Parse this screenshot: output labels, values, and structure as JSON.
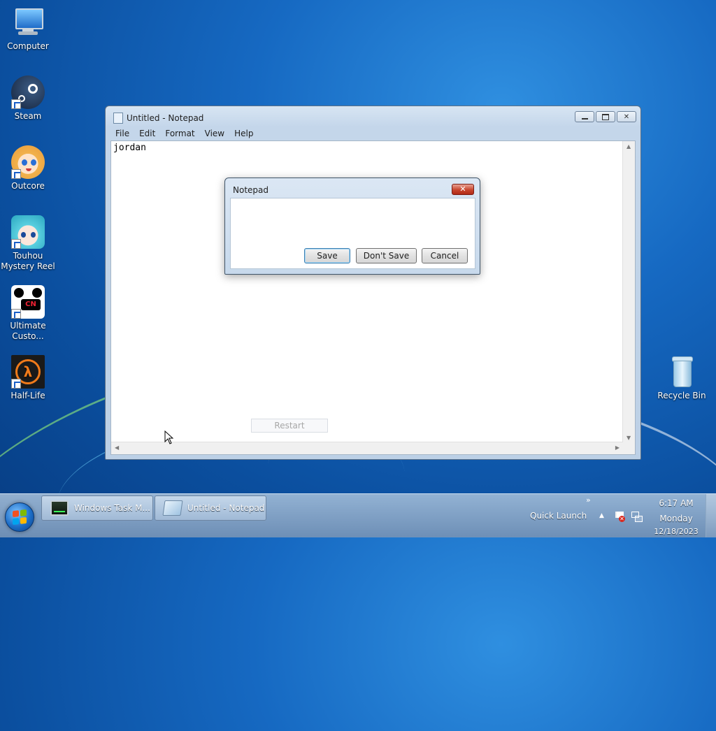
{
  "desktop": {
    "icons": [
      {
        "label": "Computer",
        "icon": "computer-icon"
      },
      {
        "label": "Steam",
        "icon": "steam-icon"
      },
      {
        "label": "Outcore",
        "icon": "outcore-icon"
      },
      {
        "label": "Touhou\nMystery Reel",
        "icon": "touhou-icon"
      },
      {
        "label": "Ultimate\nCusto...",
        "icon": "ultimate-custom-icon"
      },
      {
        "label": "Half-Life",
        "icon": "half-life-icon"
      },
      {
        "label": "Recycle Bin",
        "icon": "recycle-bin-icon"
      }
    ]
  },
  "notepad": {
    "title": "Untitled - Notepad",
    "menu": [
      "File",
      "Edit",
      "Format",
      "View",
      "Help"
    ],
    "content": "jordan",
    "restart_label": "Restart"
  },
  "dialog": {
    "title": "Notepad",
    "close_label": "✕",
    "buttons": {
      "save": "Save",
      "dont_save": "Don't Save",
      "cancel": "Cancel"
    }
  },
  "taskbar": {
    "items": [
      {
        "label": "Windows Task M...",
        "icon": "task-manager-icon"
      },
      {
        "label": "Untitled - Notepad",
        "icon": "notepad-icon"
      }
    ],
    "quick_launch": "Quick Launch",
    "chevron": "»",
    "clock": {
      "time": "6:17 AM",
      "day": "Monday",
      "date": "12/18/2023"
    }
  },
  "colors": {
    "accent": "#1669c2",
    "close_red": "#c8452e"
  }
}
